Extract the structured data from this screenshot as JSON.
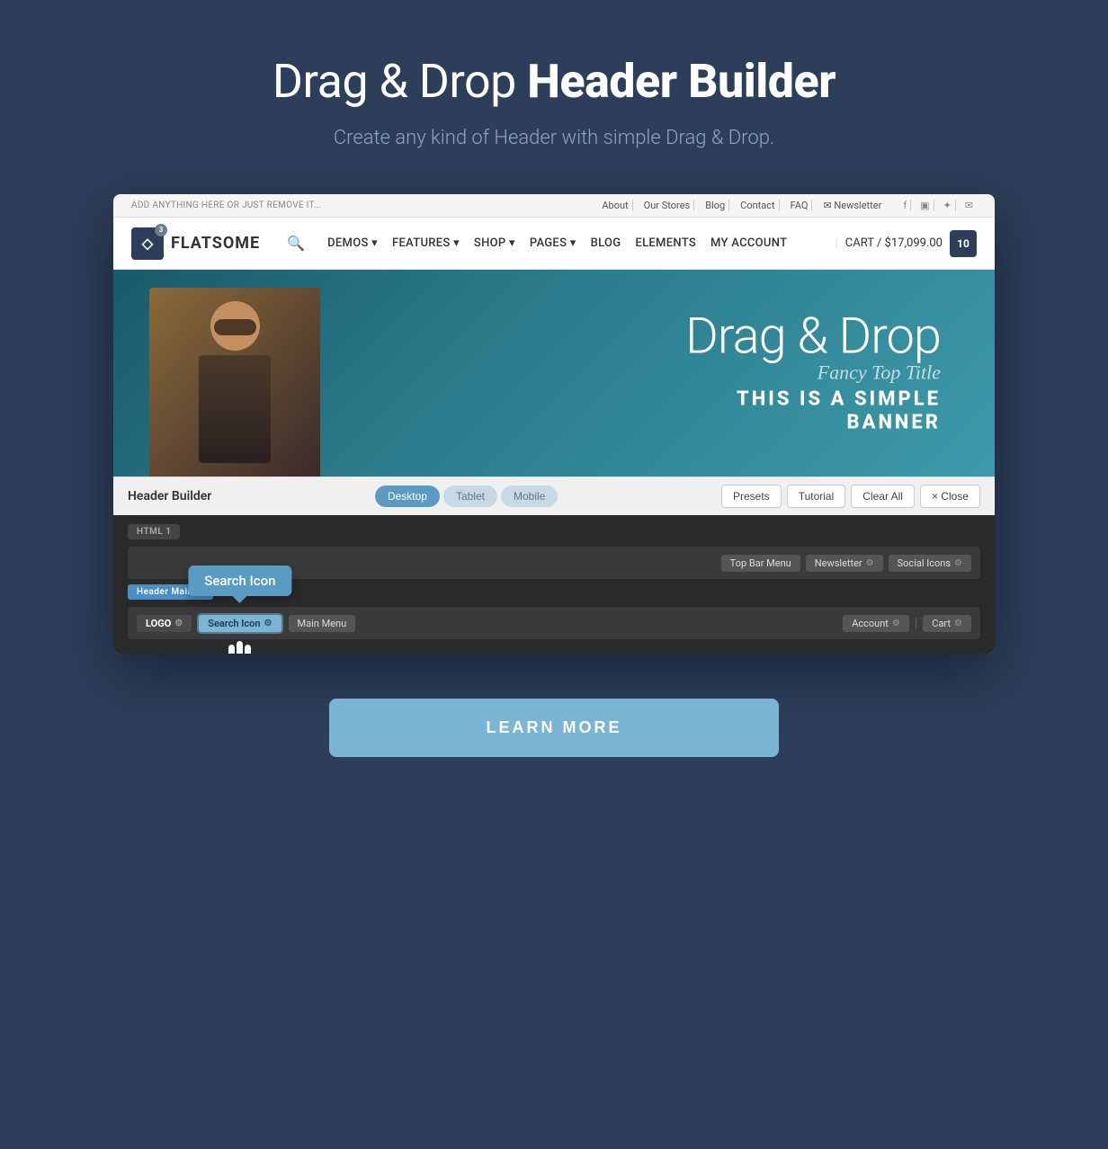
{
  "page": {
    "title_normal": "Drag & Drop ",
    "title_bold": "Header Builder",
    "subtitle": "Create any kind of Header with simple Drag & Drop.",
    "learn_more_label": "LEARN MORE"
  },
  "top_bar": {
    "left_text": "ADD ANYTHING HERE OR JUST REMOVE IT...",
    "nav_items": [
      "About",
      "Our Stores",
      "Blog",
      "Contact",
      "FAQ",
      "Newsletter"
    ]
  },
  "main_nav": {
    "logo_text": "FLATSOME",
    "logo_badge": "3",
    "nav_items": [
      "DEMOS",
      "FEATURES",
      "SHOP",
      "PAGES",
      "BLOG",
      "ELEMENTS",
      "MY ACCOUNT"
    ],
    "cart_text": "CART / $17,099.00",
    "cart_count": "10"
  },
  "hero": {
    "main_text": "Drag & Drop",
    "fancy_text": "Fancy Top Title",
    "sub_text": "THIS IS A SIMPLE\nBANNER"
  },
  "builder": {
    "title": "Header Builder",
    "tabs": [
      {
        "label": "Desktop",
        "active": true
      },
      {
        "label": "Tablet",
        "active": false
      },
      {
        "label": "Mobile",
        "active": false
      }
    ],
    "buttons": [
      "Presets",
      "Tutorial",
      "Clear All",
      "× Close"
    ],
    "rows": {
      "html_label": "HTML 1",
      "header_main_label": "Header Main",
      "html_right_items": [
        "Top Bar Menu",
        "Newsletter",
        "Social Icons"
      ],
      "main_left_items": [
        "LOGO",
        "Search Icon",
        "Main Menu"
      ],
      "tooltip_text": "Search Icon",
      "right_items": [
        "Account",
        "Cart"
      ]
    }
  }
}
